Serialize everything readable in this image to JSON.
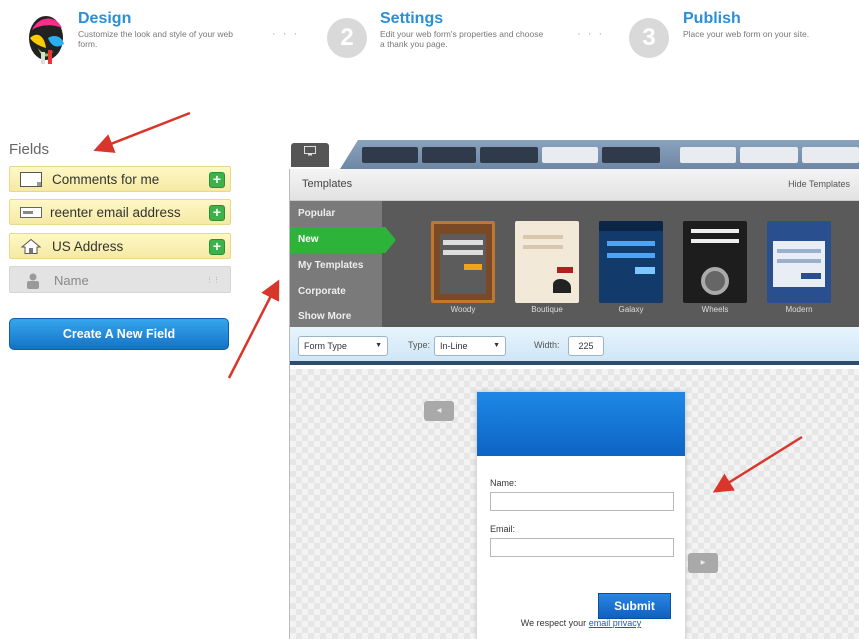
{
  "wizard": {
    "steps": [
      {
        "number": "1",
        "title": "Design",
        "description": "Customize the look and style of your web form."
      },
      {
        "number": "2",
        "title": "Settings",
        "description": "Edit your web form's properties and choose a thank you page."
      },
      {
        "number": "3",
        "title": "Publish",
        "description": "Place your web form on your site."
      }
    ],
    "separator": "· · ·"
  },
  "fields_panel": {
    "heading": "Fields",
    "items": [
      {
        "label": "Comments for me",
        "icon": "textarea-icon"
      },
      {
        "label": "reenter email address",
        "icon": "email-field-icon"
      },
      {
        "label": "US Address",
        "icon": "house-icon"
      }
    ],
    "add_symbol": "+",
    "added_item": {
      "label": "Name",
      "icon": "person-icon"
    },
    "create_button": "Create A New Field"
  },
  "editor": {
    "templates": {
      "title": "Templates",
      "hide_label": "Hide Templates",
      "categories": [
        "Popular",
        "New",
        "My Templates",
        "Corporate",
        "Show More"
      ],
      "active_category": "New",
      "thumbnails": [
        {
          "name": "Woody",
          "color": "#7a4a26"
        },
        {
          "name": "Boutique",
          "color": "#f3e9d8"
        },
        {
          "name": "Galaxy",
          "color": "#123a6b"
        },
        {
          "name": "Wheels",
          "color": "#1d1d1d"
        },
        {
          "name": "Modern",
          "color": "#2a4f8f"
        }
      ]
    },
    "options": {
      "form_type": "Form Type",
      "type_label": "Type:",
      "type_value": "In-Line",
      "width_label": "Width:",
      "width_value": "225"
    },
    "preview": {
      "name_label": "Name:",
      "email_label": "Email:",
      "submit_label": "Submit",
      "privacy_prefix": "We respect your",
      "privacy_link": "email privacy"
    }
  },
  "colors": {
    "accent_blue": "#2a8fd6",
    "add_green": "#3cb24a",
    "arrow_red": "#d9362b"
  }
}
